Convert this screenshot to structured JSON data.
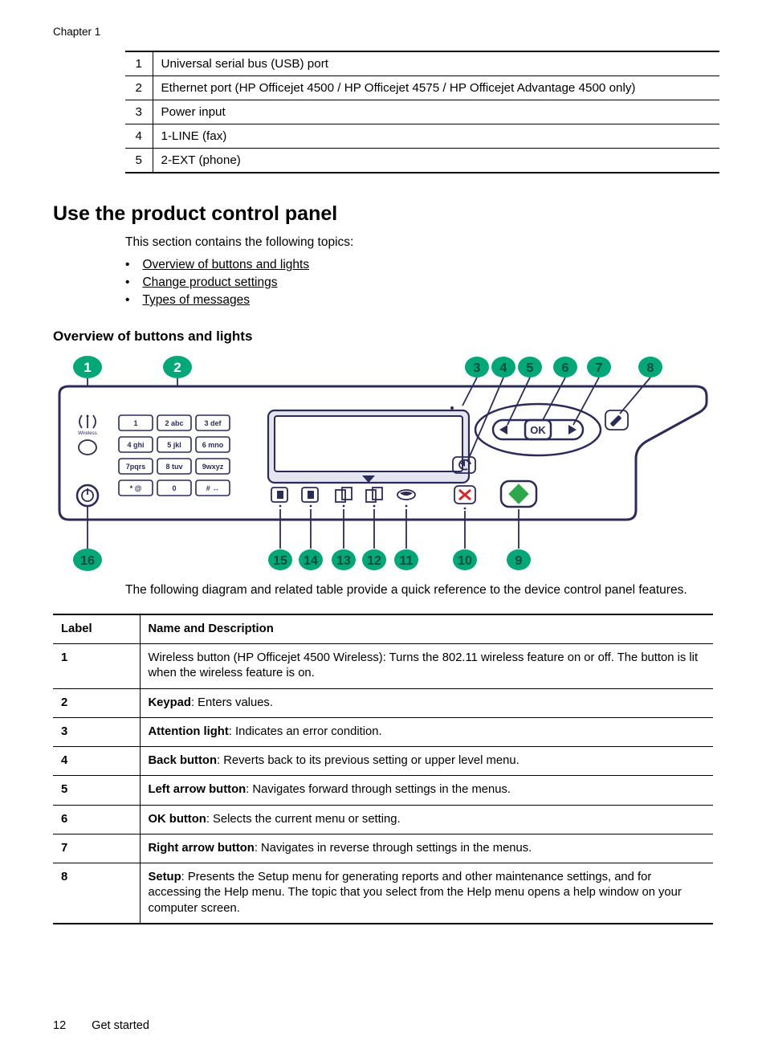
{
  "chapter": "Chapter 1",
  "portsTable": [
    {
      "num": "1",
      "desc": "Universal serial bus (USB) port"
    },
    {
      "num": "2",
      "desc": "Ethernet port (HP Officejet 4500 / HP Officejet 4575 / HP Officejet Advantage 4500 only)"
    },
    {
      "num": "3",
      "desc": "Power input"
    },
    {
      "num": "4",
      "desc": "1-LINE (fax)"
    },
    {
      "num": "5",
      "desc": "2-EXT (phone)"
    }
  ],
  "sectionTitle": "Use the product control panel",
  "sectionIntro": "This section contains the following topics:",
  "topics": [
    "Overview of buttons and lights",
    "Change product settings",
    "Types of messages"
  ],
  "subheading": "Overview of buttons and lights",
  "diagram": {
    "callouts": [
      "1",
      "2",
      "3",
      "4",
      "5",
      "6",
      "7",
      "8",
      "9",
      "10",
      "11",
      "12",
      "13",
      "14",
      "15",
      "16"
    ],
    "keypad": [
      [
        "1",
        "2 abc",
        "3 def"
      ],
      [
        "4 ghi",
        "5 jkl",
        "6 mno"
      ],
      [
        "7pqrs",
        "8 tuv",
        "9wxyz"
      ],
      [
        "* @",
        "0",
        "# ↔"
      ]
    ],
    "okLabel": "OK",
    "wirelessLabel": "Wireless"
  },
  "diagramDesc": "The following diagram and related table provide a quick reference to the device control panel features.",
  "featuresTable": {
    "header": {
      "label": "Label",
      "desc": "Name and Description"
    },
    "rows": [
      {
        "label": "1",
        "name": "",
        "desc": "Wireless button (HP Officejet 4500 Wireless): Turns the 802.11 wireless feature on or off. The button is lit when the wireless feature is on."
      },
      {
        "label": "2",
        "name": "Keypad",
        "desc": ": Enters values."
      },
      {
        "label": "3",
        "name": "Attention light",
        "desc": ": Indicates an error condition."
      },
      {
        "label": "4",
        "name": "Back button",
        "desc": ": Reverts back to its previous setting or upper level menu."
      },
      {
        "label": "5",
        "name": "Left arrow button",
        "desc": ": Navigates forward through settings in the menus."
      },
      {
        "label": "6",
        "name": "OK button",
        "desc": ": Selects the current menu or setting."
      },
      {
        "label": "7",
        "name": "Right arrow button",
        "desc": ": Navigates in reverse through settings in the menus."
      },
      {
        "label": "8",
        "name": "Setup",
        "desc": ": Presents the Setup menu for generating reports and other maintenance settings, and for accessing the Help menu. The topic that you select from the Help menu opens a help window on your computer screen."
      }
    ]
  },
  "footer": {
    "page": "12",
    "title": "Get started"
  }
}
